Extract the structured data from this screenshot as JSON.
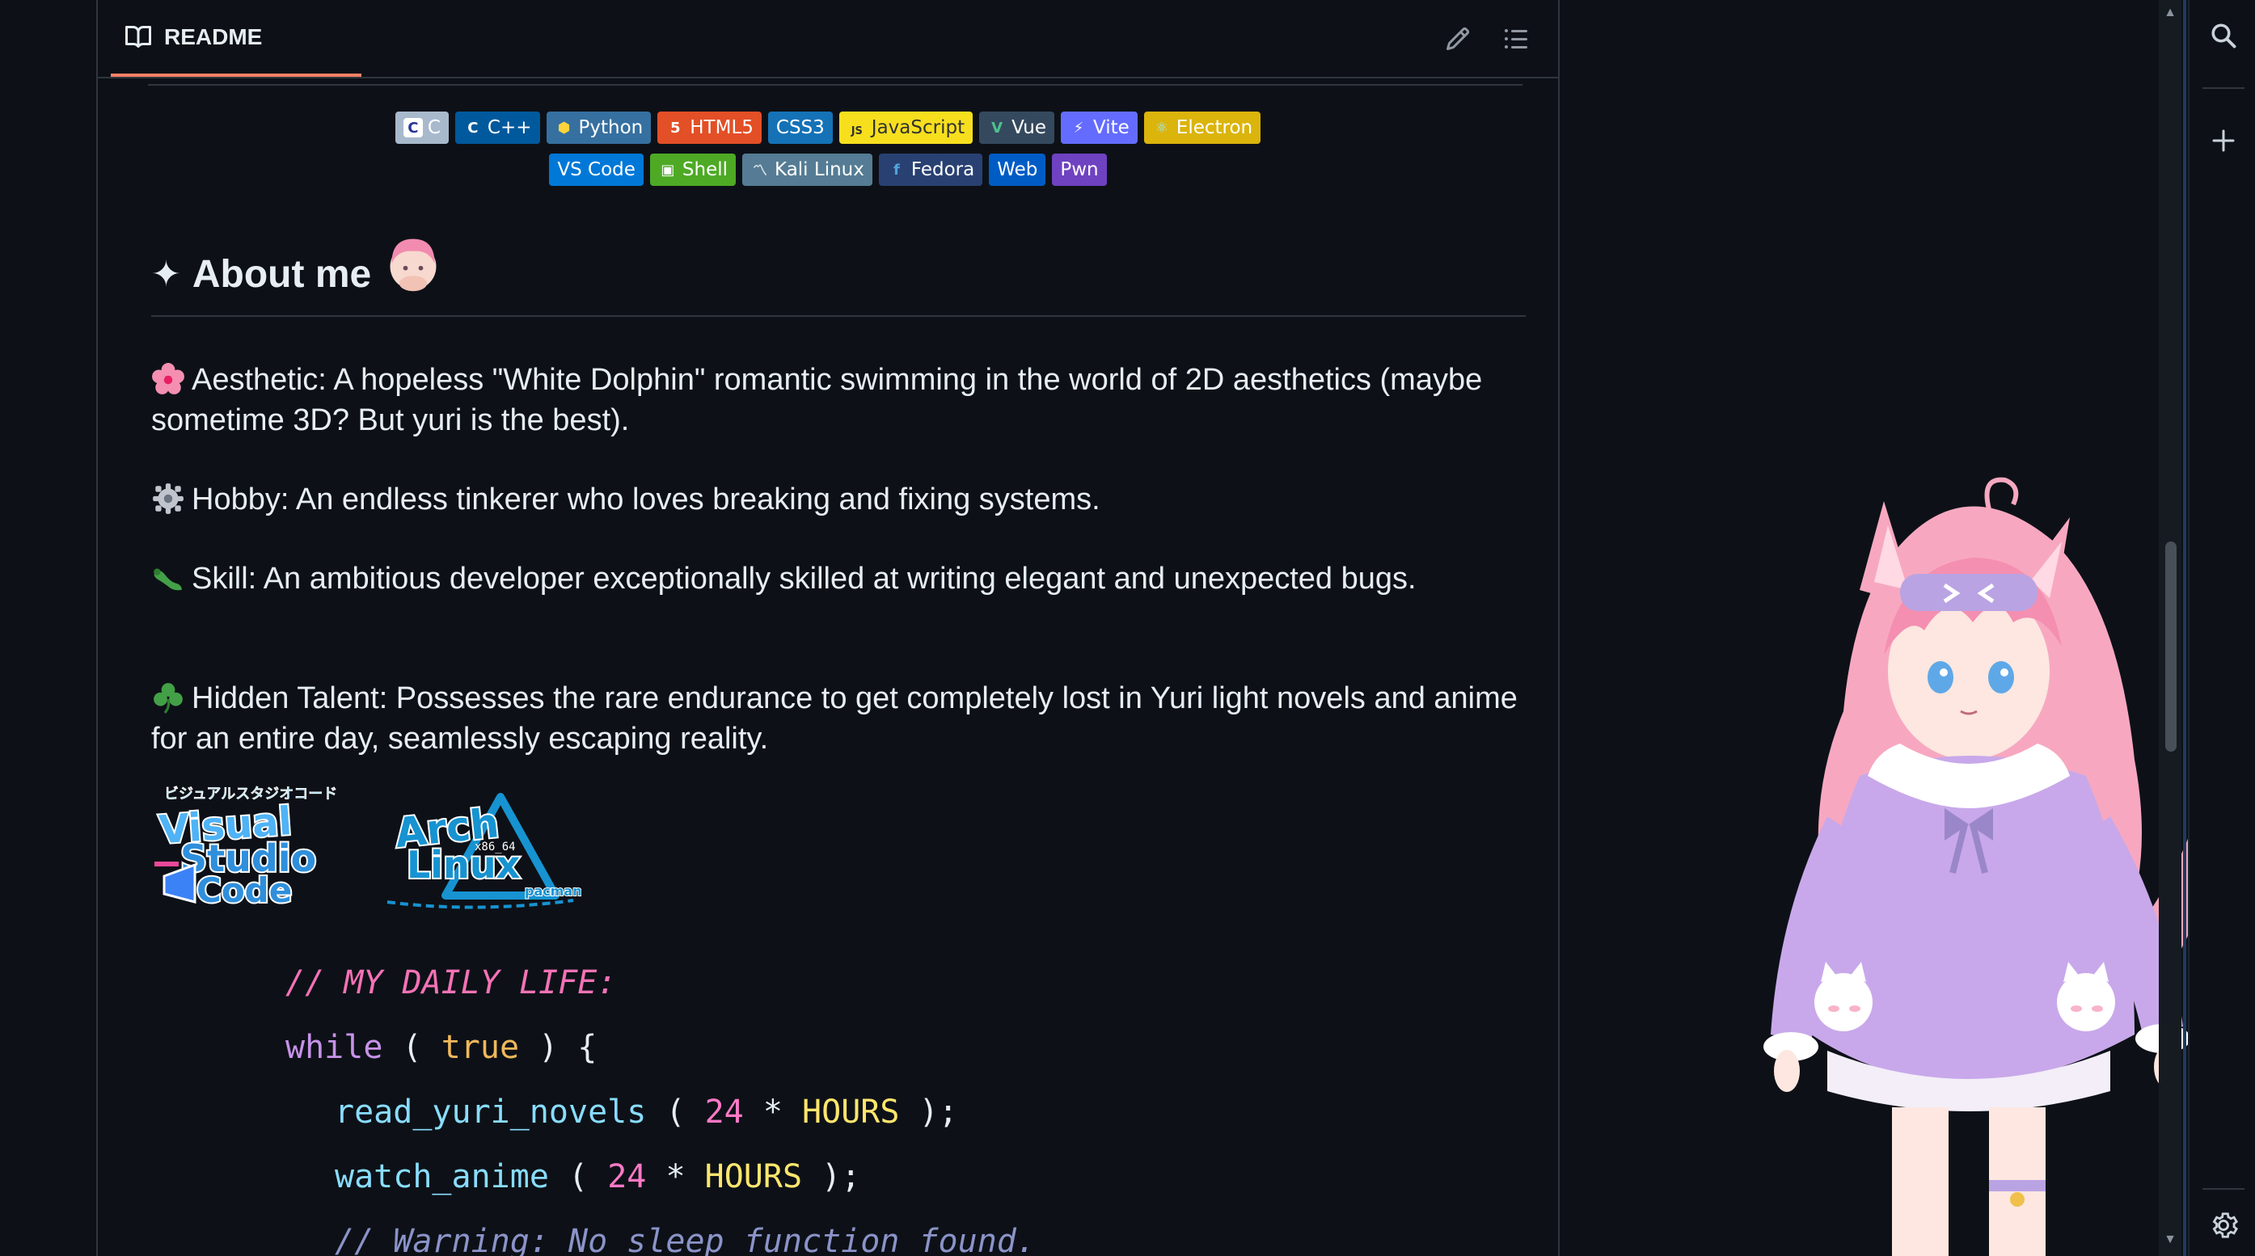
{
  "readme": {
    "tab_label": "README",
    "edit_icon": "pencil-icon",
    "toc_icon": "list-icon"
  },
  "badges_row1": [
    {
      "label": "C",
      "bg": "#a8b9cc",
      "fg": "#ffffff",
      "icon": "c-logo"
    },
    {
      "label": "C++",
      "bg": "#00599c",
      "fg": "#ffffff",
      "icon": "cpp-logo"
    },
    {
      "label": "Python",
      "bg": "#3670a0",
      "fg": "#ffffff",
      "icon": "python-logo"
    },
    {
      "label": "HTML5",
      "bg": "#e34f26",
      "fg": "#ffffff",
      "icon": "html5-logo"
    },
    {
      "label": "CSS3",
      "bg": "#1572b6",
      "fg": "#ffffff",
      "icon": ""
    },
    {
      "label": "JavaScript",
      "bg": "#f7df1e",
      "fg": "#323330",
      "icon": "js-logo"
    },
    {
      "label": "Vue",
      "bg": "#35495e",
      "fg": "#ffffff",
      "icon": "vue-logo"
    },
    {
      "label": "Vite",
      "bg": "#646cff",
      "fg": "#ffffff",
      "icon": "vite-logo"
    },
    {
      "label": "Electron",
      "bg": "#dbb40c",
      "fg": "#ffffff",
      "icon": "electron-logo"
    }
  ],
  "badges_row2": [
    {
      "label": "VS Code",
      "bg": "#0078d7",
      "fg": "#ffffff",
      "icon": ""
    },
    {
      "label": "Shell",
      "bg": "#4eaa25",
      "fg": "#ffffff",
      "icon": "shell-logo"
    },
    {
      "label": "Kali Linux",
      "bg": "#557c94",
      "fg": "#ffffff",
      "icon": "kali-logo"
    },
    {
      "label": "Fedora",
      "bg": "#294172",
      "fg": "#ffffff",
      "icon": "fedora-logo"
    },
    {
      "label": "Web",
      "bg": "#005cc5",
      "fg": "#ffffff",
      "icon": ""
    },
    {
      "label": "Pwn",
      "bg": "#6f42c1",
      "fg": "#ffffff",
      "icon": ""
    }
  ],
  "about": {
    "heading": "About me",
    "star": "✦"
  },
  "paragraphs": [
    {
      "icon": "cherry-blossom-icon",
      "text": "Aesthetic: A hopeless \"White Dolphin\" romantic swimming in the world of 2D aesthetics (maybe sometime 3D? But yuri is the best)."
    },
    {
      "icon": "gear-icon",
      "text": "Hobby: An endless tinkerer who loves breaking and fixing systems."
    },
    {
      "icon": "bug-icon",
      "text": "Skill: An ambitious developer exceptionally skilled at writing elegant and unexpected bugs."
    },
    {
      "icon": "shamrock-icon",
      "text": "Hidden Talent: Possesses the rare endurance to get completely lost in Yuri light novels and anime for an entire day, seamlessly escaping reality."
    }
  ],
  "stickers": {
    "vscode_line1": "Visual",
    "vscode_line2": "Studio",
    "vscode_line3": "Code",
    "vscode_kana": "ビジュアルスタジオコード",
    "arch_line1": "Arch",
    "arch_line2": "Linux",
    "arch_arch": "x86_64",
    "arch_pacman": "pacman"
  },
  "code": {
    "line1": "// MY DAILY LIFE:",
    "kw_while": "while",
    "p_open": "(",
    "true": "true",
    "p_close_brace": ") {",
    "fn1": "read_yuri_novels",
    "fn2": "watch_anime",
    "num": "24",
    "star": "*",
    "hours": "HOURS",
    "end": ");",
    "warn": "// Warning: No sleep function found."
  },
  "rail": {
    "search_icon": "search-icon",
    "plus_icon": "plus-icon",
    "settings_icon": "gear-icon"
  }
}
